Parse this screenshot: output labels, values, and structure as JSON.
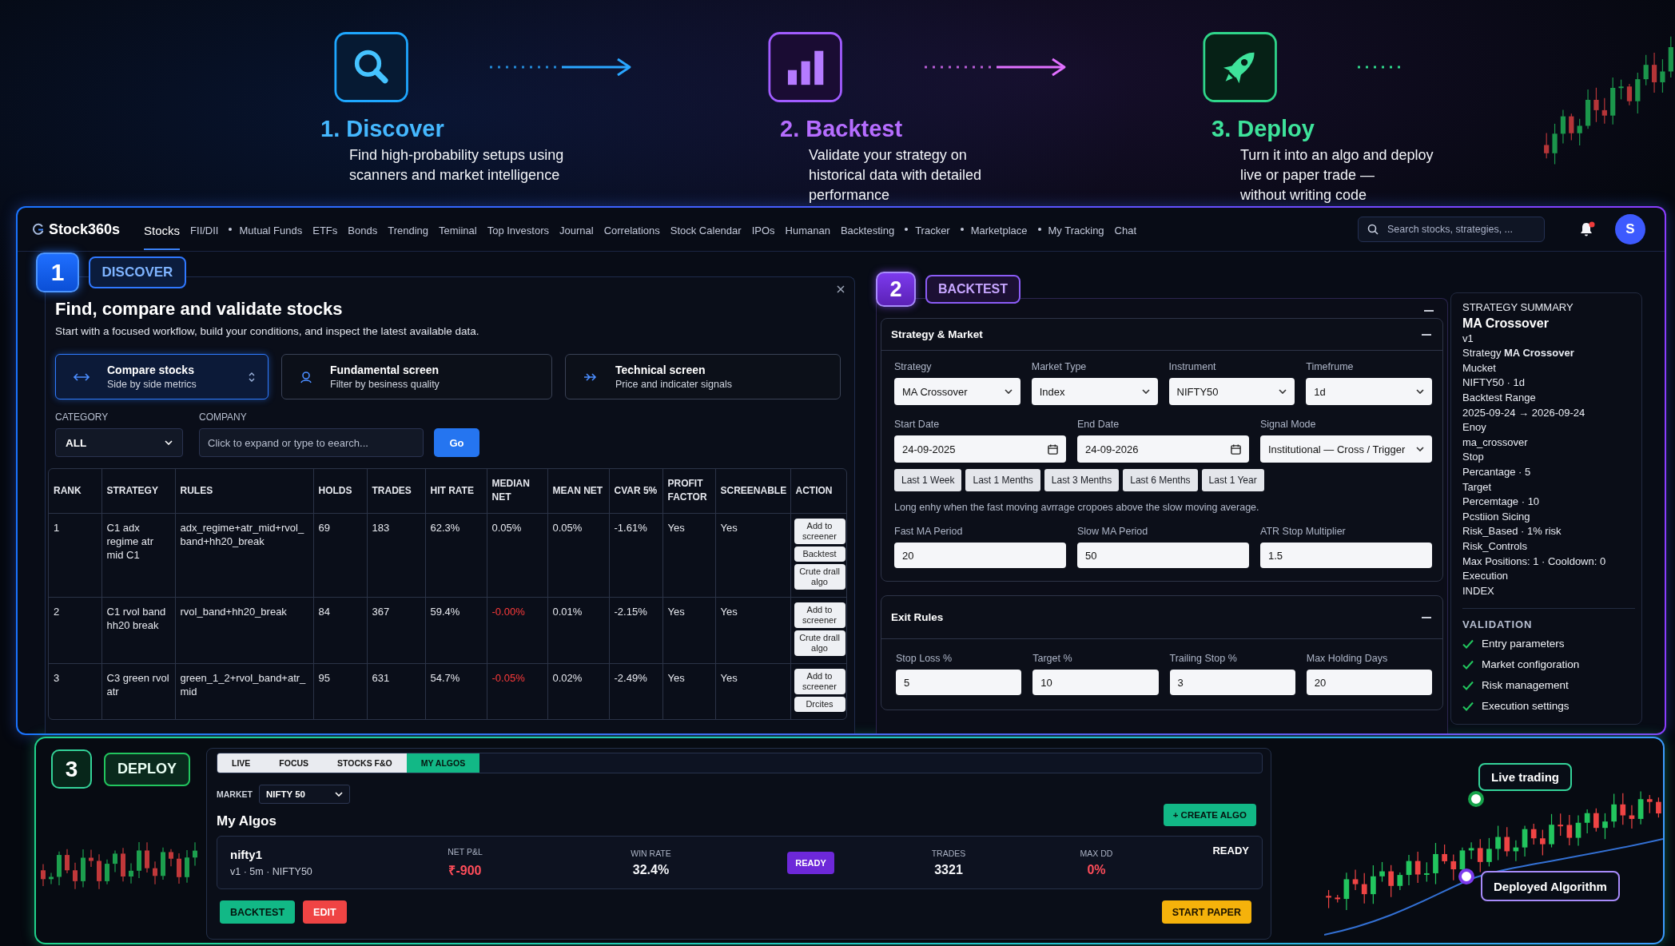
{
  "steps": [
    {
      "kind": "discover",
      "title": "1. Discover",
      "description": "Find high-probability setups using\nscanners and market intelligence"
    },
    {
      "kind": "backtest",
      "title": "2. Backtest",
      "description": "Validate your strategy on\nhistorical data with detailed\nperformance"
    },
    {
      "kind": "deploy",
      "title": "3. Deploy",
      "description": "Turn it into an algo and deploy\nlive or paper trade —\nwithout writing code"
    }
  ],
  "nav": {
    "logo": "Stock360s",
    "items": [
      {
        "label": "Stocks",
        "selected": true,
        "dot_before": false
      },
      {
        "label": "FII/DII",
        "selected": false,
        "dot_before": false
      },
      {
        "label": "Mutual Funds",
        "selected": false,
        "dot_before": true
      },
      {
        "label": "ETFs",
        "selected": false,
        "dot_before": false
      },
      {
        "label": "Bonds",
        "selected": false,
        "dot_before": false
      },
      {
        "label": "Trending",
        "selected": false,
        "dot_before": false
      },
      {
        "label": "Temiinal",
        "selected": false,
        "dot_before": false
      },
      {
        "label": "Top Investors",
        "selected": false,
        "dot_before": false
      },
      {
        "label": "Journal",
        "selected": false,
        "dot_before": false
      },
      {
        "label": "Correlations",
        "selected": false,
        "dot_before": false
      },
      {
        "label": "Stock Calendar",
        "selected": false,
        "dot_before": false
      },
      {
        "label": "IPOs",
        "selected": false,
        "dot_before": false
      },
      {
        "label": "Humanan",
        "selected": false,
        "dot_before": false
      },
      {
        "label": "Backtesting",
        "selected": false,
        "dot_before": false
      },
      {
        "label": "Tracker",
        "selected": false,
        "dot_before": true
      },
      {
        "label": "Marketplace",
        "selected": false,
        "dot_before": true
      },
      {
        "label": "My Tracking",
        "selected": false,
        "dot_before": true
      },
      {
        "label": "Chat",
        "selected": false,
        "dot_before": false
      }
    ],
    "search": {
      "placeholder": "Search stocks, strategies, ..."
    },
    "unread": true,
    "avatar": "S"
  },
  "discover": {
    "number": "1",
    "label": "DISCOVER",
    "title": "Find, compare and validate stocks",
    "subtitle": "Start with a focused workflow, build your conditions, and inspect the latest available data.",
    "modes": [
      {
        "kind": "compare",
        "title": "Compare stocks",
        "subtitle": "Side by side metrics",
        "selected": true
      },
      {
        "kind": "fundamental",
        "title": "Fundamental screen",
        "subtitle": "Filter by besiness quality",
        "selected": false
      },
      {
        "kind": "technical",
        "title": "Technical screen",
        "subtitle": "Price and indicater signals",
        "selected": false
      }
    ],
    "category": {
      "label": "CATEGORY",
      "value": "ALL"
    },
    "company": {
      "label": "COMPANY",
      "placeholder": "Click to expand or type to eearch..."
    },
    "go": "Go",
    "table": {
      "columns": [
        "RANK",
        "STRATEGY",
        "RULES",
        "HOLDS",
        "TRADES",
        "HIT RATE",
        "MEDIAN NET",
        "MEAN NET",
        "CVAR 5%",
        "PROFIT FACTOR",
        "SCREENABLE",
        "ACTION"
      ],
      "rows": [
        {
          "rank": "1",
          "strategy": "C1 adx regime atr mid C1",
          "rules": "adx_regime+atr_mid+rvol_band+hh20_break",
          "holds": "69",
          "trades": "183",
          "hit_rate": "62.3%",
          "median_net": "0.05%",
          "median_negative": false,
          "mean_net": "0.05%",
          "cvar": "-1.61%",
          "profit_factor": "Yes",
          "screenable": "Yes",
          "actions": [
            "Add to screener",
            "Backtest",
            "Crute drall algo"
          ]
        },
        {
          "rank": "2",
          "strategy": "C1 rvol band hh20 break",
          "rules": "rvol_band+hh20_break",
          "holds": "84",
          "trades": "367",
          "hit_rate": "59.4%",
          "median_net": "-0.00%",
          "median_negative": true,
          "mean_net": "0.01%",
          "cvar": "-2.15%",
          "profit_factor": "Yes",
          "screenable": "Yes",
          "actions": [
            "Add to screener",
            "Crute drall algo"
          ]
        },
        {
          "rank": "3",
          "strategy": "C3 green rvol atr",
          "rules": "green_1_2+rvol_band+atr_mid",
          "holds": "95",
          "trades": "631",
          "hit_rate": "54.7%",
          "median_net": "-0.05%",
          "median_negative": true,
          "mean_net": "0.02%",
          "cvar": "-2.49%",
          "profit_factor": "Yes",
          "screenable": "Yes",
          "actions": [
            "Add to screener",
            "Drcites"
          ]
        }
      ]
    }
  },
  "backtest": {
    "number": "2",
    "label": "BACKTEST",
    "strategy": {
      "title": "Strategy & Market",
      "selectors": [
        {
          "kind": "select",
          "label": "Strategy",
          "value": "MA Crossover"
        },
        {
          "kind": "select",
          "label": "Market Type",
          "value": "Index"
        },
        {
          "kind": "select",
          "label": "Instrument",
          "value": "NIFTY50"
        },
        {
          "kind": "select",
          "label": "Timefrume",
          "value": "1d"
        }
      ],
      "period": [
        {
          "kind": "date",
          "label": "Start Date",
          "value": "24-09-2025"
        },
        {
          "kind": "date",
          "label": "End Date",
          "value": "24-09-2026"
        },
        {
          "kind": "select",
          "label": "Signal Mode",
          "value": "Institutional — Cross / Trigger"
        }
      ],
      "presets": [
        "Last 1 Week",
        "Last 1 Menths",
        "Last 3 Menths",
        "Last 6 Menths",
        "Last 1 Year"
      ],
      "description": "Long enhy when the fast moving avrrage cropoes above the slow moving average.",
      "params": [
        {
          "label": "Fast MA Period",
          "value": "20"
        },
        {
          "label": "Slow MA Period",
          "value": "50"
        },
        {
          "label": "ATR Stop Multiplier",
          "value": "1.5"
        }
      ]
    },
    "exit": {
      "title": "Exit Rules",
      "fields": [
        {
          "label": "Stop Loss %",
          "value": "5"
        },
        {
          "label": "Target %",
          "value": "10"
        },
        {
          "label": "Trailing Stop %",
          "value": "3"
        },
        {
          "label": "Max Holding Days",
          "value": "20"
        }
      ]
    },
    "summary": {
      "heading": "STRATEGY SUMMARY",
      "title": "MA Crossover",
      "lines": [
        "v1",
        "Strategy **MA Crossover**",
        "Mucket",
        "NIFTY50 · 1d",
        "Backtest Range",
        "2025-09-24 → 2026-09-24",
        "Enoy",
        "ma_crossover",
        "Stop",
        "Percantage · 5",
        "Target",
        "Percemtage · 10",
        "Pcstiion Sicing",
        "Risk_Based · 1% risk",
        "Risk_Controls",
        "Max Positions: 1 · Cooldown: 0",
        "Execution",
        "INDEX"
      ]
    },
    "validation": {
      "heading": "VALIDATION",
      "items": [
        {
          "label": "Entry parameters",
          "checked": true
        },
        {
          "label": "Market configoration",
          "checked": true
        },
        {
          "label": "Risk management",
          "checked": true
        },
        {
          "label": "Execution settings",
          "checked": true
        }
      ]
    }
  },
  "deploy": {
    "number": "3",
    "label": "DEPLOY",
    "tabs": [
      {
        "label": "LIVE",
        "selected": false
      },
      {
        "label": "FOCUS",
        "selected": false
      },
      {
        "label": "STOCKS F&O",
        "selected": false
      },
      {
        "label": "MY ALGOS",
        "selected": true
      }
    ],
    "market": {
      "label": "MARKET",
      "value": "NIFTY 50"
    },
    "heading": "My Algos",
    "create": "+ CREATE ALGO",
    "algo": {
      "name": "nifty1",
      "meta": "v1 · 5m · NIFTY50",
      "stats": [
        {
          "kind": "stat",
          "label": "NET P&L",
          "value": "₹-900",
          "negative": true
        },
        {
          "kind": "stat",
          "label": "WIN RATE",
          "value": "32.4%",
          "negative": false
        },
        {
          "kind": "badge",
          "label": "READY"
        },
        {
          "kind": "stat",
          "label": "TRADES",
          "value": "3321",
          "negative": false
        },
        {
          "kind": "stat",
          "label": "MAX DD",
          "value": "0%",
          "negative": true
        }
      ],
      "status": "READY"
    },
    "actions": [
      {
        "kind": "primary",
        "label": "BACKTEST"
      },
      {
        "kind": "danger",
        "label": "EDIT"
      },
      {
        "kind": "warning",
        "label": "START PAPER"
      }
    ],
    "chart_labels": [
      {
        "kind": "live",
        "text": "Live trading"
      },
      {
        "kind": "deployed",
        "text": "Deployed Algorithm"
      }
    ]
  }
}
